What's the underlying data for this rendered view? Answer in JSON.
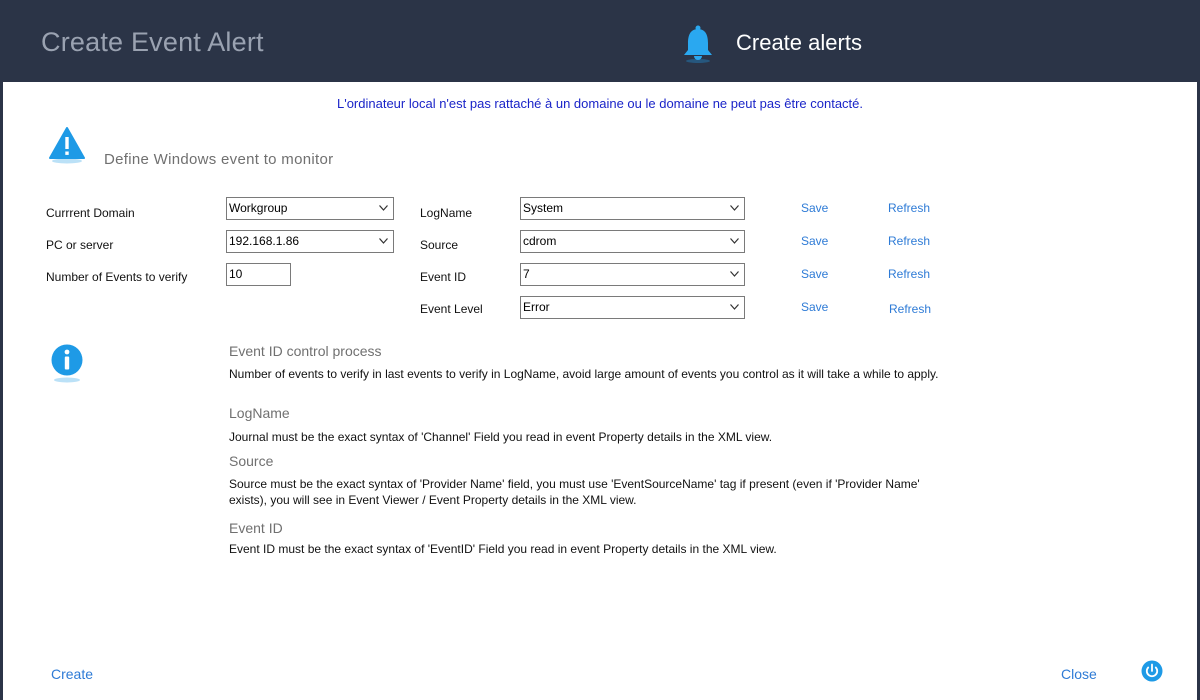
{
  "header": {
    "app_title": "Create Event Alert",
    "section_title": "Create alerts",
    "bell_icon": "bell-icon"
  },
  "domain_message": "L'ordinateur local n'est pas rattaché à un domaine ou le domaine ne peut pas être contacté.",
  "define": {
    "title": "Define Windows event to monitor",
    "icon": "warning-icon"
  },
  "form": {
    "current_domain_label": "Currrent Domain",
    "current_domain_value": "Workgroup",
    "pc_label": "PC or server",
    "pc_value": "192.168.1.86",
    "events_count_label": "Number of Events to verify",
    "events_count_value": "10",
    "logname_label": "LogName",
    "logname_value": "System",
    "source_label": "Source",
    "source_value": "cdrom",
    "eventid_label": "Event ID",
    "eventid_value": "7",
    "eventlevel_label": "Event Level",
    "eventlevel_value": "Error",
    "save_label": "Save",
    "refresh_label": "Refresh"
  },
  "help": {
    "icon": "info-icon",
    "h1": "Event ID control process",
    "t1": "Number of events to verify in last events to verify in LogName, avoid large amount of events you control as it will take a while to apply.",
    "h2": "LogName",
    "t2": "Journal must be the exact syntax of 'Channel' Field you read in event Property details in the XML view.",
    "h3": "Source",
    "t3": "Source must be the exact syntax of 'Provider Name' field, you must use 'EventSourceName' tag if present (even if 'Provider Name' exists), you will see in Event Viewer / Event Property details in the XML view.",
    "h4": "Event ID",
    "t4": "Event ID must be the exact syntax of 'EventID' Field you read in event Property details in the XML view."
  },
  "footer": {
    "create_label": "Create",
    "close_label": "Close",
    "power_icon": "power-icon"
  },
  "colors": {
    "header_bg": "#2b3447",
    "link": "#2e7bd6",
    "message": "#1a24c8",
    "icon_blue": "#1e9ae6"
  }
}
